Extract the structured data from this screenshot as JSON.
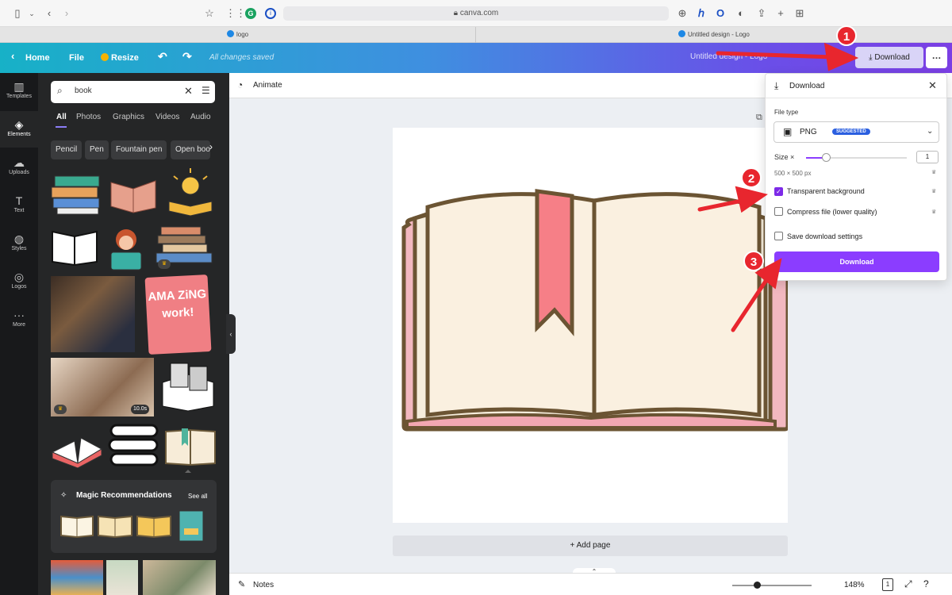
{
  "browser": {
    "url": "canva.com",
    "tabs": [
      {
        "label": "logo"
      },
      {
        "label": "Untitled design - Logo"
      }
    ]
  },
  "header": {
    "home": "Home",
    "file": "File",
    "resize": "Resize",
    "status": "All changes saved",
    "design_title": "Untitled design - Logo",
    "download": "Download"
  },
  "rail": [
    {
      "label": "Templates"
    },
    {
      "label": "Elements"
    },
    {
      "label": "Uploads"
    },
    {
      "label": "Text"
    },
    {
      "label": "Styles"
    },
    {
      "label": "Logos"
    },
    {
      "label": "More"
    }
  ],
  "panel": {
    "search_value": "book",
    "tabs": [
      "All",
      "Photos",
      "Graphics",
      "Videos",
      "Audio"
    ],
    "chips": [
      "Pencil",
      "Pen",
      "Fountain pen",
      "Open boo"
    ],
    "video_duration": "10.0s",
    "magic_title": "Magic Recommendations",
    "see_all": "See all",
    "sticker_text": "AMA ZiNG work!"
  },
  "canvas": {
    "animate": "Animate",
    "add_page": "+ Add page",
    "notes": "Notes",
    "zoom": "148%",
    "page_count": "1"
  },
  "download_panel": {
    "title": "Download",
    "file_type_label": "File type",
    "file_type": "PNG",
    "suggested_badge": "SUGGESTED",
    "size_label": "Size ×",
    "size_value": "1",
    "dimensions": "500 × 500 px",
    "transparent_label": "Transparent background",
    "transparent_checked": true,
    "compress_label": "Compress file (lower quality)",
    "save_settings_label": "Save download settings",
    "download_button": "Download"
  },
  "annotations": [
    "1",
    "2",
    "3"
  ],
  "colors": {
    "accent_purple": "#8b3dff",
    "annotation_red": "#e8262e",
    "badge_blue": "#2b5fe0"
  }
}
